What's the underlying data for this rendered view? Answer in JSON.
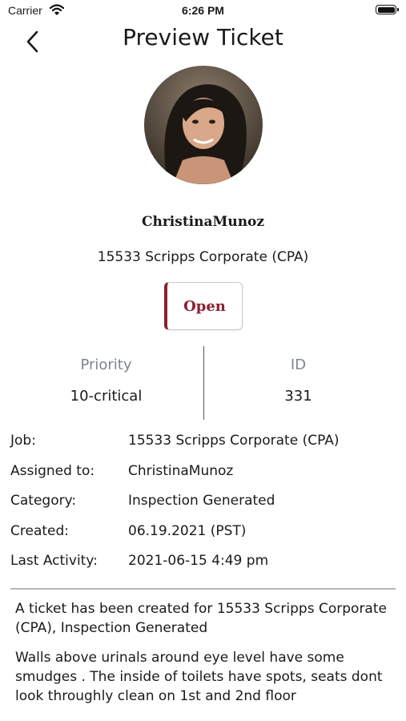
{
  "status_bar": {
    "carrier": "Carrier",
    "time": "6:26 PM"
  },
  "nav": {
    "title": "Preview Ticket"
  },
  "user": {
    "name": "ChristinaMunoz",
    "job": "15533 Scripps Corporate (CPA)"
  },
  "status_button": {
    "label": "Open",
    "accent": "#8b2030"
  },
  "stats": {
    "priority_label": "Priority",
    "priority_value": "10-critical",
    "id_label": "ID",
    "id_value": "331"
  },
  "details": [
    {
      "label": "Job:",
      "value": "15533 Scripps Corporate (CPA)"
    },
    {
      "label": "Assigned to:",
      "value": "ChristinaMunoz"
    },
    {
      "label": "Category:",
      "value": "Inspection Generated"
    },
    {
      "label": "Created:",
      "value": "06.19.2021 (PST)"
    },
    {
      "label": "Last Activity:",
      "value": "2021-06-15 4:49 pm"
    }
  ],
  "description": {
    "summary": "A ticket has been created for 15533 Scripps Corporate (CPA), Inspection Generated",
    "notes": "Walls above urinals around eye level have some smudges . The inside of toilets have spots, seats dont look throughly clean on 1st and 2nd floor"
  }
}
